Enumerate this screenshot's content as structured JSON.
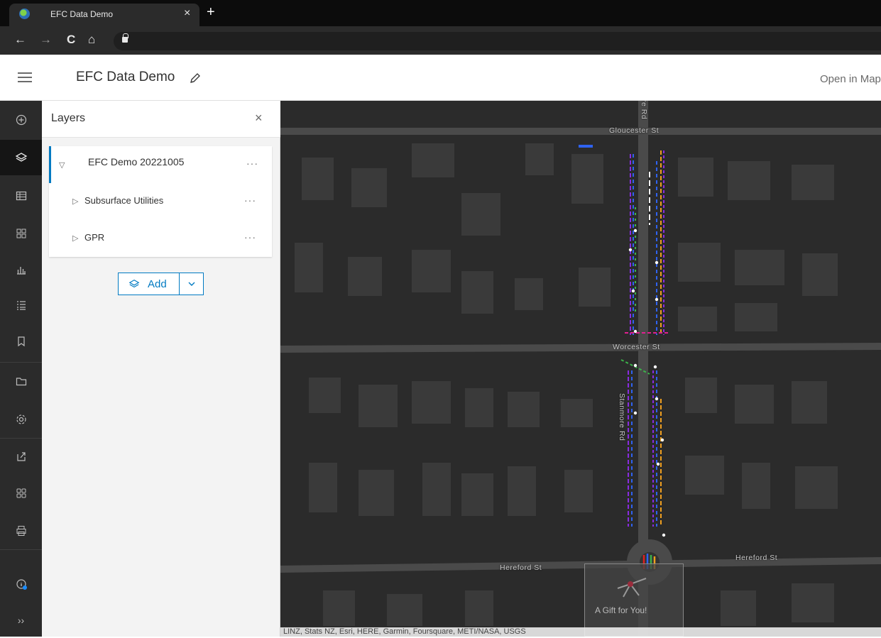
{
  "browser": {
    "tab_title": "EFC Data Demo",
    "close_tab_glyph": "×",
    "new_tab_glyph": "+",
    "back_glyph": "←",
    "forward_glyph": "→",
    "reload_glyph": "C",
    "home_glyph": "⌂"
  },
  "header": {
    "title": "EFC Data Demo",
    "open_link": "Open in Map"
  },
  "toolbar": {
    "items": [
      {
        "icon": "plus-circle-icon"
      },
      {
        "icon": "layers-icon",
        "active": true
      },
      {
        "icon": "table-icon"
      },
      {
        "icon": "grid-view-icon"
      },
      {
        "icon": "bar-chart-icon"
      },
      {
        "icon": "legend-icon"
      },
      {
        "icon": "bookmark-icon"
      },
      {
        "icon": "folder-icon"
      },
      {
        "icon": "settings-icon"
      },
      {
        "icon": "share-icon"
      },
      {
        "icon": "apps-icon"
      },
      {
        "icon": "print-icon"
      },
      {
        "icon": "info-icon"
      },
      {
        "icon": "expand-icon"
      }
    ],
    "expand_glyph": "››"
  },
  "layers_panel": {
    "title": "Layers",
    "close_glyph": "×",
    "group": {
      "label": "EFC Demo 20221005",
      "menu": "···"
    },
    "layers": [
      {
        "label": "Subsurface Utilities",
        "menu": "···"
      },
      {
        "label": "GPR",
        "menu": "···"
      }
    ],
    "add_button": "Add"
  },
  "map": {
    "streets": {
      "gloucester": "Gloucester St",
      "worcester": "Worcester St",
      "stanmore": "Stanmore Rd",
      "stanmore_top": "re Rd",
      "hereford_left": "Hereford St",
      "hereford_right": "Hereford St"
    },
    "popup_text": "A Gift for You!",
    "attribution": "LINZ, Stats NZ, Esri, HERE, Garmin, Foursquare, METI/NASA, USGS",
    "colors": {
      "purple": "#8a2be2",
      "blue": "#2f62f0",
      "orange": "#f0a020",
      "green": "#3cb34a",
      "white": "#ffffff"
    }
  }
}
